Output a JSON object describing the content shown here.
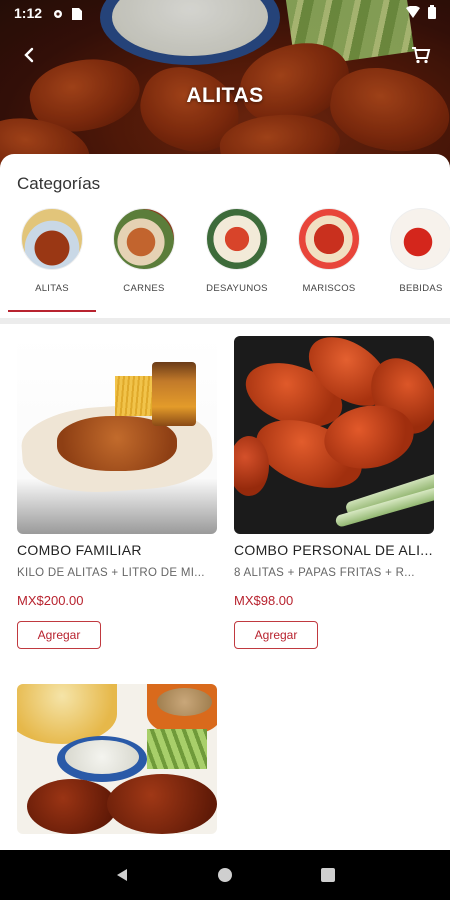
{
  "status_bar": {
    "time": "1:12",
    "icons": [
      "gear-icon",
      "sim-card-icon",
      "wifi-icon",
      "battery-icon"
    ]
  },
  "header": {
    "title": "ALITAS",
    "back_icon": "back-arrow-icon",
    "cart_icon": "cart-icon"
  },
  "categories": {
    "heading": "Categorías",
    "selected": "ALITAS",
    "items": [
      {
        "label": "ALITAS"
      },
      {
        "label": "CARNES"
      },
      {
        "label": "DESAYUNOS"
      },
      {
        "label": "MARISCOS"
      },
      {
        "label": "BEBIDAS"
      }
    ]
  },
  "products": [
    {
      "name": "COMBO FAMILIAR",
      "description": "KILO DE ALITAS + LITRO DE MI...",
      "price": "MX$200.00",
      "button_label": "Agregar"
    },
    {
      "name": "COMBO PERSONAL DE ALI...",
      "description": "8 ALITAS + PAPAS FRITAS + R...",
      "price": "MX$98.00",
      "button_label": "Agregar"
    },
    {
      "name": "",
      "description": "",
      "price": "",
      "button_label": ""
    }
  ],
  "nav_bar": {
    "icons": [
      "nav-back-icon",
      "nav-home-icon",
      "nav-recents-icon"
    ]
  },
  "colors": {
    "accent": "#b8232f",
    "nav_bar": "#000000"
  }
}
